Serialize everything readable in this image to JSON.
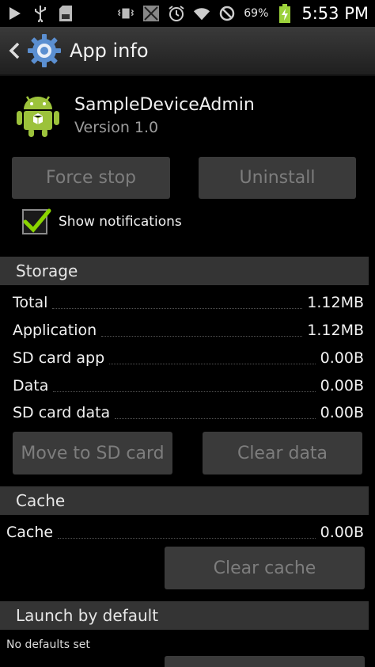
{
  "status_bar": {
    "left_icons": [
      "play-icon",
      "usb-icon",
      "sd-card-icon"
    ],
    "right_icons": [
      "vibrate-icon",
      "screenshot-icon",
      "alarm-icon",
      "wifi-icon",
      "no-sim-icon",
      "battery-charging-icon"
    ],
    "battery": "69%",
    "time": "5:53 PM"
  },
  "action_bar": {
    "title": "App info"
  },
  "app": {
    "name": "SampleDeviceAdmin",
    "version": "Version 1.0"
  },
  "buttons": {
    "force_stop": "Force stop",
    "uninstall": "Uninstall"
  },
  "notifications": {
    "label": "Show notifications",
    "checked": true
  },
  "storage": {
    "header": "Storage",
    "rows": [
      {
        "label": "Total",
        "value": "1.12MB"
      },
      {
        "label": "Application",
        "value": "1.12MB"
      },
      {
        "label": "SD card app",
        "value": "0.00B"
      },
      {
        "label": "Data",
        "value": "0.00B"
      },
      {
        "label": "SD card data",
        "value": "0.00B"
      }
    ],
    "move_button": "Move to SD card",
    "clear_data_button": "Clear data"
  },
  "cache": {
    "header": "Cache",
    "label": "Cache",
    "value": "0.00B",
    "clear_button": "Clear cache"
  },
  "launch": {
    "header": "Launch by default",
    "text": "No defaults set"
  },
  "colors": {
    "accent_check": "#8ad400",
    "android_green": "#9cc23b"
  }
}
